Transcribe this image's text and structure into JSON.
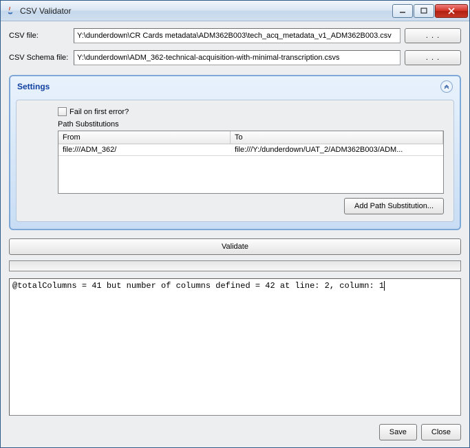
{
  "window": {
    "title": "CSV Validator"
  },
  "files": {
    "csv_label": "CSV file:",
    "csv_value": "Y:\\dunderdown\\CR Cards metadata\\ADM362B003\\tech_acq_metadata_v1_ADM362B003.csv",
    "schema_label": "CSV Schema file:",
    "schema_value": "Y:\\dunderdown\\ADM_362-technical-acquisition-with-minimal-transcription.csvs",
    "browse_label": ". . ."
  },
  "settings": {
    "title": "Settings",
    "fail_label": "Fail on first error?",
    "fail_checked": false,
    "path_sub_label": "Path Substitutions",
    "table": {
      "col_from": "From",
      "col_to": "To",
      "rows": [
        {
          "from": "file:///ADM_362/",
          "to": "file:///Y:/dunderdown/UAT_2/ADM362B003/ADM..."
        }
      ]
    },
    "add_btn": "Add Path Substitution..."
  },
  "actions": {
    "validate": "Validate",
    "save": "Save",
    "close": "Close"
  },
  "output": "@totalColumns = 41 but number of columns defined = 42 at line: 2, column: 1"
}
